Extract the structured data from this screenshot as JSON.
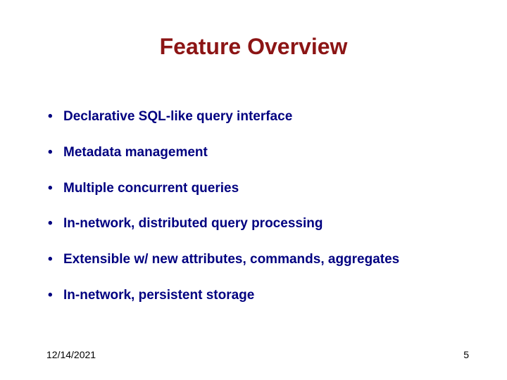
{
  "title": "Feature Overview",
  "bullets": {
    "item0": "Declarative SQL-like query interface",
    "item1": "Metadata management",
    "item2": "Multiple concurrent queries",
    "item3": "In-network, distributed query processing",
    "item4": "Extensible w/ new attributes, commands, aggregates",
    "item5": "In-network, persistent storage"
  },
  "footer": {
    "date": "12/14/2021",
    "page": "5"
  }
}
